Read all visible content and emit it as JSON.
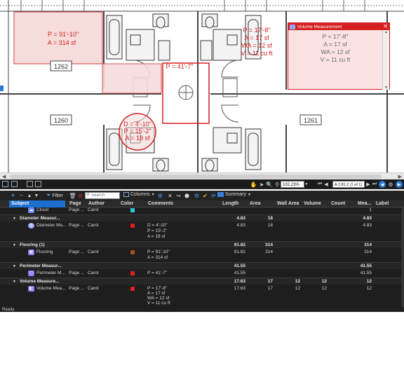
{
  "drawing": {
    "rooms": [
      "1262",
      "1260",
      "1261"
    ],
    "flooring_markup": {
      "line1": "P = 91'-10\"",
      "line2": "A = 314 sf"
    },
    "perimeter_markup": {
      "line1": "P = 41'-7\""
    },
    "diameter_markup": {
      "line1": "D = 4'-10\"",
      "line2": "P = 15'-2\"",
      "line3": "A = 18 sf"
    },
    "volume_markup_bg": {
      "line1": "P = 17'-8\"",
      "line2": "A = 17 sf",
      "line3": "WA = 12 sf",
      "line4": "V = 11 cu ft"
    },
    "volume_popup": {
      "title": "Volume Measurement",
      "line1": "P = 17'-8\"",
      "line2": "A = 17 sf",
      "line3": "WA = 12 sf",
      "line4": "V = 11 cu ft"
    }
  },
  "navbar": {
    "zoom": "102.23%",
    "page": "A 2.81.2 (1 of 1)"
  },
  "toolbar": {
    "filter_label": "Filter",
    "search_placeholder": "Search",
    "columns_label": "Columns",
    "summary_label": "Summary"
  },
  "table": {
    "headers": [
      "Subject",
      "Page",
      "Author",
      "Color",
      "Comments",
      "Length",
      "Area",
      "Wall Area",
      "Volume",
      "Count",
      "Mea...",
      "Label"
    ],
    "rows": [
      {
        "kind": "item",
        "subject": "Cloud",
        "page": "Page ...",
        "author": "Carol",
        "color": "#2ec4d6",
        "comments": [],
        "length": "",
        "area": "",
        "wall": "",
        "volume": "",
        "count": "",
        "mea": "1",
        "icon": "cloud-icon"
      },
      {
        "kind": "group",
        "subject": "Diameter Measur...",
        "length": "4.83",
        "area": "18",
        "wall": "",
        "volume": "",
        "count": "",
        "mea": "4.83"
      },
      {
        "kind": "item",
        "subject": "Diameter Me...",
        "page": "Page ...",
        "author": "Carol",
        "color": "#e02020",
        "comments": [
          "D = 4'-10\"",
          "P = 15'-2\"",
          "A = 18 sf"
        ],
        "length": "4.83",
        "area": "18",
        "wall": "",
        "volume": "",
        "count": "",
        "mea": "4.83",
        "icon": "diameter-icon"
      },
      {
        "kind": "group",
        "subject": "Flooring (1)",
        "length": "91.82",
        "area": "314",
        "wall": "",
        "volume": "",
        "count": "",
        "mea": "314"
      },
      {
        "kind": "item",
        "subject": "Flooring",
        "page": "Page ...",
        "author": "Carol",
        "color": "#a0501e",
        "comments": [
          "P = 91'-10\"",
          "A = 314 sf"
        ],
        "length": "91.82",
        "area": "314",
        "wall": "",
        "volume": "",
        "count": "",
        "mea": "314",
        "icon": "flooring-icon"
      },
      {
        "kind": "group",
        "subject": "Perimeter Measur...",
        "length": "41.55",
        "area": "",
        "wall": "",
        "volume": "",
        "count": "",
        "mea": "41.55"
      },
      {
        "kind": "item",
        "subject": "Perimeter M...",
        "page": "Page ...",
        "author": "Carol",
        "color": "#e02020",
        "comments": [
          "P = 41'-7\""
        ],
        "length": "41.55",
        "area": "",
        "wall": "",
        "volume": "",
        "count": "",
        "mea": "41.55",
        "icon": "perimeter-icon"
      },
      {
        "kind": "group",
        "subject": "Volume Measure...",
        "length": "17.63",
        "area": "17",
        "wall": "12",
        "volume": "12",
        "count": "",
        "mea": "12"
      },
      {
        "kind": "item",
        "subject": "Volume Mea...",
        "page": "Page ...",
        "author": "Carol",
        "color": "#e02020",
        "comments": [
          "P = 17'-8\"",
          "A = 17 sf",
          "WA = 12 sf",
          "V = 11 cu ft"
        ],
        "length": "17.63",
        "area": "17",
        "wall": "12",
        "volume": "12",
        "count": "",
        "mea": "12",
        "icon": "volume-icon"
      }
    ]
  },
  "status": {
    "text": "Ready"
  }
}
